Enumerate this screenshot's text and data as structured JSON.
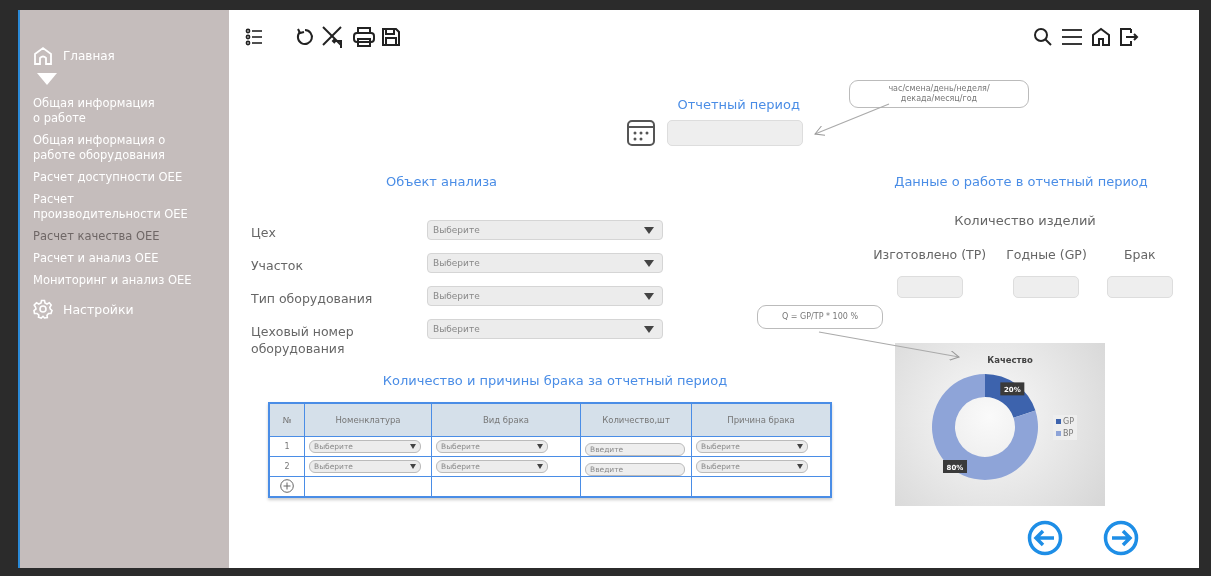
{
  "sidebar": {
    "home": {
      "label": "Главная",
      "expanded": true
    },
    "items": [
      {
        "label": "Общая информация\nо работе",
        "selected": false
      },
      {
        "label": "Общая информация о\nработе оборудования",
        "selected": false
      },
      {
        "label": "Расчет доступности OEE",
        "selected": false
      },
      {
        "label": "Расчет\nпроизводительности OEE",
        "selected": false
      },
      {
        "label": "Расчет качества OEE",
        "selected": true
      },
      {
        "label": "Расчет и анализ OEE",
        "selected": false
      },
      {
        "label": "Мониторинг и анализ OEE",
        "selected": false
      }
    ],
    "settings": {
      "label": "Настройки"
    }
  },
  "report_period": {
    "title": "Отчетный период",
    "callout": "час/смена/день/неделя/\nдекада/месяц/год"
  },
  "analysis_object": {
    "title": "Объект анализа",
    "fields": [
      {
        "label": "Цех",
        "placeholder": "Выберите"
      },
      {
        "label": "Участок",
        "placeholder": "Выберите"
      },
      {
        "label": "Тип оборудования",
        "placeholder": "Выберите"
      },
      {
        "label": "Цеховый номер\nоборудования",
        "placeholder": "Выберите"
      }
    ]
  },
  "work_data": {
    "title": "Данные о работе в отчетный период",
    "subtitle": "Количество изделий",
    "fields": [
      {
        "label": "Изготовлено (TP)"
      },
      {
        "label": "Годные (GP)"
      },
      {
        "label": "Брак"
      }
    ],
    "formula_callout": "Q = GP/TP * 100 %"
  },
  "defects": {
    "title": "Количество и причины брака за отчетный период",
    "columns": [
      "№",
      "Номенклатура",
      "Вид брака",
      "Количество,шт",
      "Причина брака"
    ],
    "rows": [
      {
        "cells": [
          {
            "kind": "text",
            "text": "1"
          },
          {
            "kind": "select",
            "placeholder": "Выберите"
          },
          {
            "kind": "select",
            "placeholder": "Выберите"
          },
          {
            "kind": "input",
            "placeholder": "Введите"
          },
          {
            "kind": "select",
            "placeholder": "Выберите"
          }
        ]
      },
      {
        "cells": [
          {
            "kind": "text",
            "text": "2"
          },
          {
            "kind": "select",
            "placeholder": "Выберите"
          },
          {
            "kind": "select",
            "placeholder": "Выберите"
          },
          {
            "kind": "input",
            "placeholder": "Введите"
          },
          {
            "kind": "select",
            "placeholder": "Выберите"
          }
        ]
      }
    ]
  },
  "chart_data": {
    "type": "donut",
    "title": "Качество",
    "categories": [
      "GP",
      "BP"
    ],
    "values": [
      20,
      80
    ],
    "legend": "right",
    "colors": [
      "#3d63ad",
      "#8ea4d8"
    ],
    "value_labels": [
      "20%",
      "80%"
    ]
  }
}
